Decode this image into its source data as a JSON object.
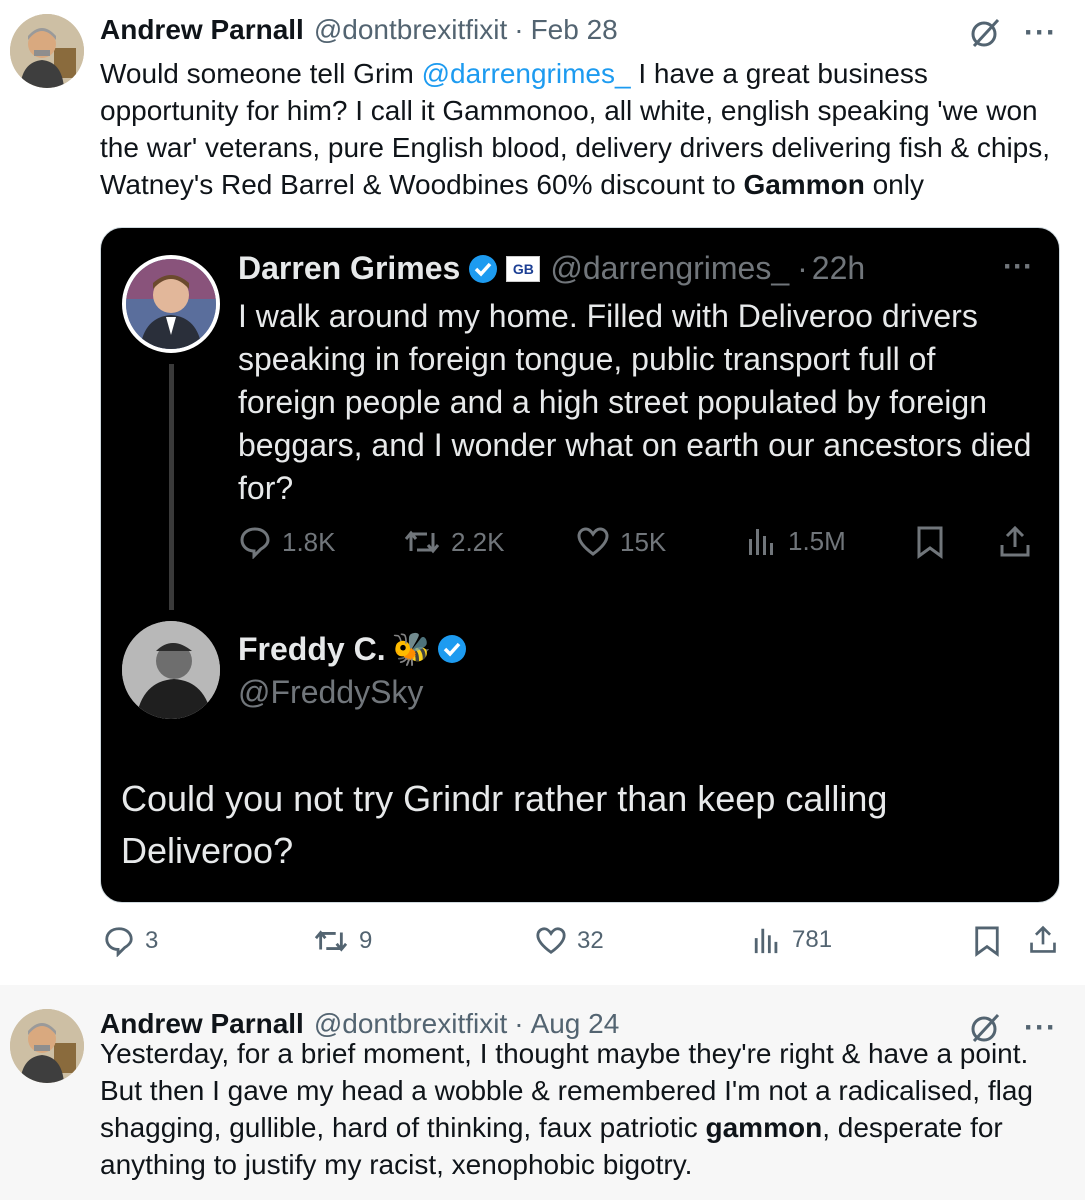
{
  "tweet1": {
    "author_name": "Andrew Parnall",
    "author_handle": "@dontbrexitfixit",
    "separator": "·",
    "date": "Feb 28",
    "more": "···",
    "text_before_mention": "Would someone tell Grim ",
    "mention": "@darrengrimes_",
    "text_after_mention": " I have a great business opportunity for him? I call it Gammonoo, all white, english speaking 'we won the war' veterans, pure English blood, delivery drivers delivering fish & chips, Watney's Red Barrel & Woodbines 60% discount to ",
    "bold_word": "Gammon",
    "text_end": " only",
    "actions": {
      "replies": "3",
      "reposts": "9",
      "likes": "32",
      "views": "781"
    }
  },
  "quote": {
    "post1": {
      "name": "Darren Grimes",
      "badge": "GB",
      "handle": "@darrengrimes_",
      "separator": "·",
      "time": "22h",
      "more": "···",
      "text": "I walk around my home. Filled with Deliveroo drivers speaking in foreign tongue, public transport full of foreign people and a high street populated by foreign beggars, and I wonder what on earth our ancestors died for?",
      "actions": {
        "replies": "1.8K",
        "reposts": "2.2K",
        "likes": "15K",
        "views": "1.5M"
      }
    },
    "post2": {
      "name": "Freddy C.",
      "emoji": "🐝",
      "handle": "@FreddySky",
      "text": "Could you not try Grindr rather than keep calling Deliveroo?"
    }
  },
  "tweet2": {
    "author_name": "Andrew Parnall",
    "author_handle": "@dontbrexitfixit",
    "separator": "·",
    "date": "Aug 24",
    "more": "···",
    "text_before_bold": "Yesterday, for a brief moment, I thought maybe they're right & have a point. But then I gave my head a wobble & remembered I'm not a radicalised, flag shagging, gullible, hard of thinking, faux patriotic ",
    "bold_word": "gammon",
    "text_after_bold": ", desperate for anything to justify my racist, xenophobic bigotry."
  },
  "colors": {
    "accent": "#1d9bf0",
    "verified": "#1d9bf0",
    "muted": "#536471",
    "dark_bg": "#000000"
  },
  "icons": [
    "grok-icon",
    "more-icon",
    "reply-icon",
    "repost-icon",
    "like-icon",
    "views-icon",
    "bookmark-icon",
    "share-icon",
    "verified-icon"
  ]
}
